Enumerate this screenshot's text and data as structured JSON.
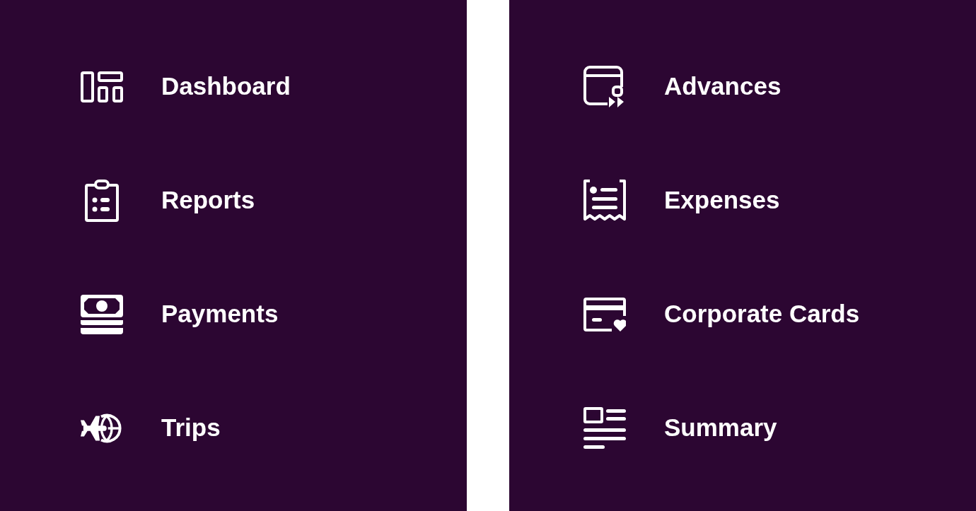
{
  "panels": [
    {
      "items": [
        {
          "label": "Dashboard"
        },
        {
          "label": "Reports"
        },
        {
          "label": "Payments"
        },
        {
          "label": "Trips"
        }
      ]
    },
    {
      "items": [
        {
          "label": "Advances"
        },
        {
          "label": "Expenses"
        },
        {
          "label": "Corporate Cards"
        },
        {
          "label": "Summary"
        }
      ]
    }
  ]
}
